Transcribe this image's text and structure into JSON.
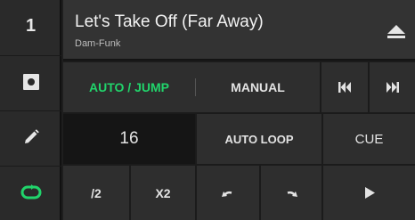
{
  "colors": {
    "accent_green": "#21d46b",
    "panel": "#2e2e2e",
    "dark_cell": "#151515"
  },
  "sidebar": {
    "deck_number": "1",
    "items": [
      {
        "icon": "record-icon"
      },
      {
        "icon": "pencil-icon"
      },
      {
        "icon": "loop-icon"
      }
    ]
  },
  "track": {
    "title": "Let's Take Off (Far Away)",
    "artist": "Dam-Funk",
    "eject_icon": "eject-icon"
  },
  "mode_tabs": {
    "auto_jump": "AUTO / JUMP",
    "manual": "MANUAL",
    "prev_icon": "skip-previous-icon",
    "next_icon": "skip-next-icon"
  },
  "loop": {
    "beats_value": "16",
    "auto_loop_label": "AUTO LOOP",
    "cue_label": "CUE"
  },
  "controls": {
    "halve_label": "/2",
    "double_label": "X2",
    "undo_icon": "undo-icon",
    "redo_icon": "redo-icon",
    "play_icon": "play-icon"
  }
}
